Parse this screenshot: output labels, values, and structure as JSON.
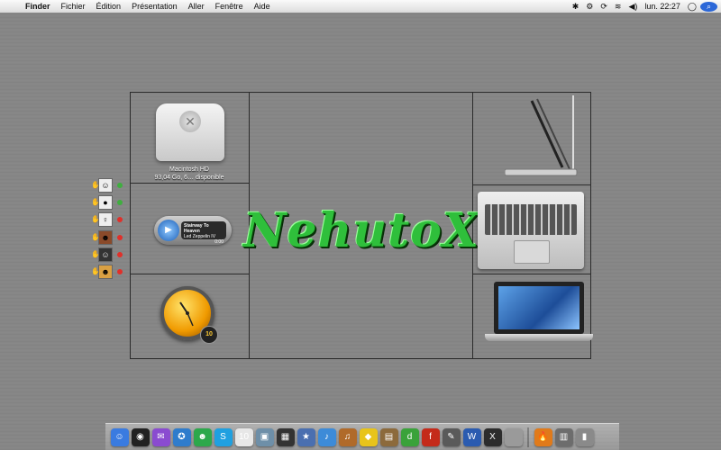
{
  "menubar": {
    "apple": "",
    "items": [
      "Finder",
      "Fichier",
      "Édition",
      "Présentation",
      "Aller",
      "Fenêtre",
      "Aide"
    ],
    "clock": "lun. 22:27"
  },
  "drive": {
    "name": "Macintosh HD",
    "info": "93,04 Go, 6… disponible"
  },
  "itunes": {
    "track": "Stairway To Heaven",
    "artist": "Led Zeppelin IV",
    "time": "0:00"
  },
  "clock_widget": {
    "badge": "10"
  },
  "logo": {
    "text": "NehutoX"
  },
  "buddies": [
    {
      "status": "#3fae3f"
    },
    {
      "status": "#3fae3f"
    },
    {
      "status": "#e0302a"
    },
    {
      "status": "#e0302a"
    },
    {
      "status": "#e0302a"
    },
    {
      "status": "#e0302a"
    }
  ],
  "dock": {
    "icons": [
      {
        "name": "finder-icon",
        "color": "#3a7be0",
        "glyph": "☺"
      },
      {
        "name": "dashboard-icon",
        "color": "#222",
        "glyph": "◉"
      },
      {
        "name": "ichat-icon",
        "color": "#8a4bd0",
        "glyph": "✉"
      },
      {
        "name": "safari-icon",
        "color": "#2f7ccc",
        "glyph": "✪"
      },
      {
        "name": "adium-icon",
        "color": "#2ca84b",
        "glyph": "☻"
      },
      {
        "name": "skype-icon",
        "color": "#1fa0e0",
        "glyph": "S"
      },
      {
        "name": "calendar-icon",
        "color": "#e7e7e7",
        "glyph": "10"
      },
      {
        "name": "photos-icon",
        "color": "#6e8fa8",
        "glyph": "▣"
      },
      {
        "name": "clapper-icon",
        "color": "#333",
        "glyph": "▦"
      },
      {
        "name": "imovie-icon",
        "color": "#4a6fb0",
        "glyph": "★"
      },
      {
        "name": "itunes-icon",
        "color": "#3d8bd8",
        "glyph": "♪"
      },
      {
        "name": "garageband-icon",
        "color": "#b06a2a",
        "glyph": "♫"
      },
      {
        "name": "duck-icon",
        "color": "#e8c41a",
        "glyph": "◆"
      },
      {
        "name": "iphoto-icon",
        "color": "#8c6a3c",
        "glyph": "▤"
      },
      {
        "name": "dreamweaver-icon",
        "color": "#3aa23a",
        "glyph": "d"
      },
      {
        "name": "flash-icon",
        "color": "#c42a1a",
        "glyph": "f"
      },
      {
        "name": "pen-icon",
        "color": "#5a5a5a",
        "glyph": "✎"
      },
      {
        "name": "word-icon",
        "color": "#2a5bb0",
        "glyph": "W"
      },
      {
        "name": "osx-icon",
        "color": "#2c2c2c",
        "glyph": "X"
      },
      {
        "name": "system-icon",
        "color": "#9a9a9a",
        "glyph": ""
      }
    ],
    "right_icons": [
      {
        "name": "firefox-icon",
        "color": "#e07a1a",
        "glyph": "🔥"
      },
      {
        "name": "downloads-icon",
        "color": "#6d6d6d",
        "glyph": "▥"
      },
      {
        "name": "trash-icon",
        "color": "#8a8a8a",
        "glyph": "▮"
      }
    ]
  }
}
